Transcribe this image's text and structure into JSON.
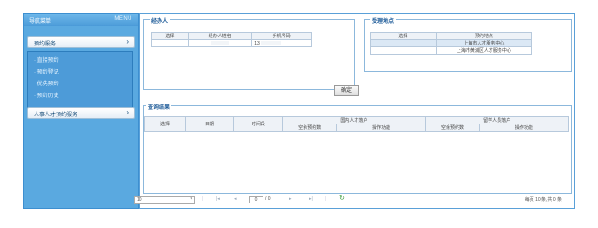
{
  "sidebar": {
    "title": "导航菜单",
    "menu_label": "MENU",
    "section1_label": "预约服务",
    "items": [
      {
        "label": "· 直接预约"
      },
      {
        "label": "· 预约登记"
      },
      {
        "label": "· 优先预约"
      },
      {
        "label": "· 预约历史"
      }
    ],
    "section2_label": "人事人才预约服务"
  },
  "agent": {
    "legend": "经办人",
    "columns": [
      "选择",
      "经办人姓名",
      "手机号码"
    ],
    "rows": [
      {
        "select": "",
        "name": "",
        "phone": "13"
      }
    ]
  },
  "location": {
    "legend": "受理地点",
    "columns": [
      "选择",
      "预约地点"
    ],
    "rows": [
      {
        "select": "",
        "place": "上海市人才服务中心"
      },
      {
        "select": "",
        "place": "上海市黄浦区人才服务中心"
      }
    ]
  },
  "confirm_label": "确定",
  "results": {
    "legend": "查询结果",
    "col_select": "选择",
    "col_date": "日期",
    "col_time": "时间段",
    "group_domestic": "国内人才落户",
    "group_overseas": "留学人员落户",
    "sub_remaining": "空余预约数",
    "sub_action": "操作功能"
  },
  "pager": {
    "page_size": "10",
    "page_input": "0",
    "page_total": "/ 0",
    "summary": "每页 10 条,共 0 条"
  }
}
